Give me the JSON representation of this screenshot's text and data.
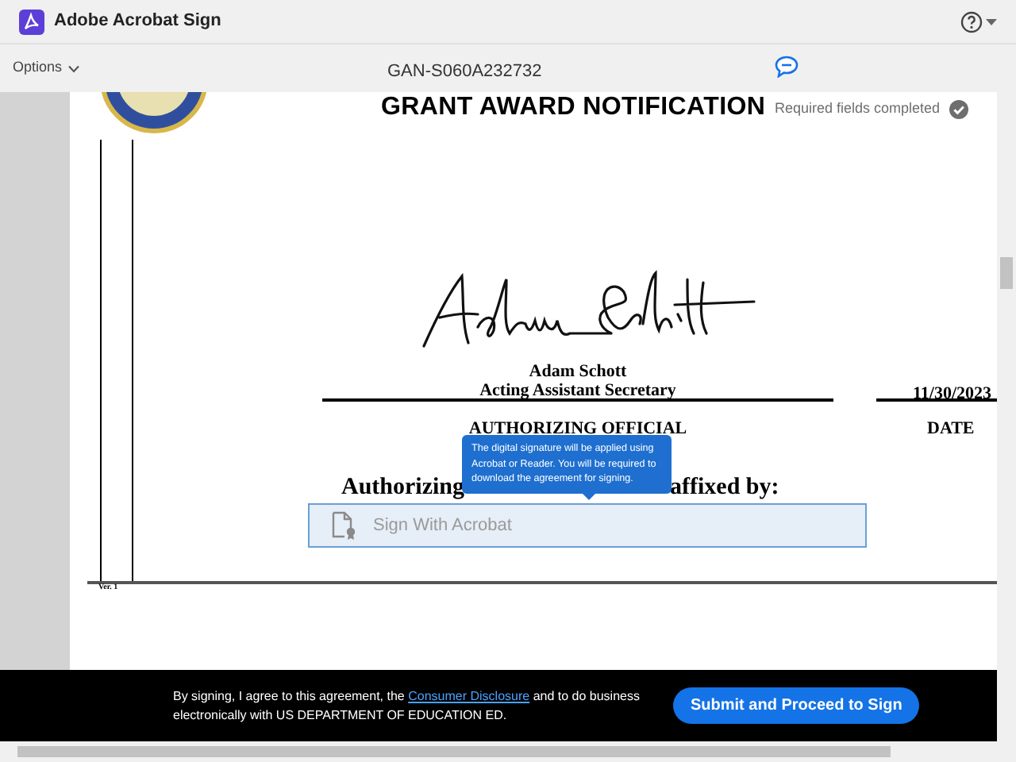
{
  "app": {
    "title": "Adobe Acrobat Sign"
  },
  "toolbar": {
    "options": "Options",
    "document_id": "GAN-S060A232732"
  },
  "status": {
    "text": "Required fields completed"
  },
  "document": {
    "title": "GRANT AWARD NOTIFICATION",
    "signer_name": "Adam Schott",
    "signer_title": "Acting Assistant Secretary",
    "date": "11/30/2023",
    "official_label": "AUTHORIZING OFFICIAL",
    "date_label": "DATE",
    "affixed_left": "Authorizing",
    "affixed_right": "affixed by:",
    "version": "Ver. 1"
  },
  "sign_field": {
    "label": "Sign With Acrobat"
  },
  "tooltip": {
    "text": "The digital signature will be applied using Acrobat or Reader. You will be required to download the agreement for signing."
  },
  "footer": {
    "consent_before": "By signing, I agree to this agreement, the",
    "consent_link": "Consumer Disclosure",
    "consent_after": "and to do business electronically with US DEPARTMENT OF EDUCATION ED.",
    "button": "Submit and Proceed to Sign"
  }
}
